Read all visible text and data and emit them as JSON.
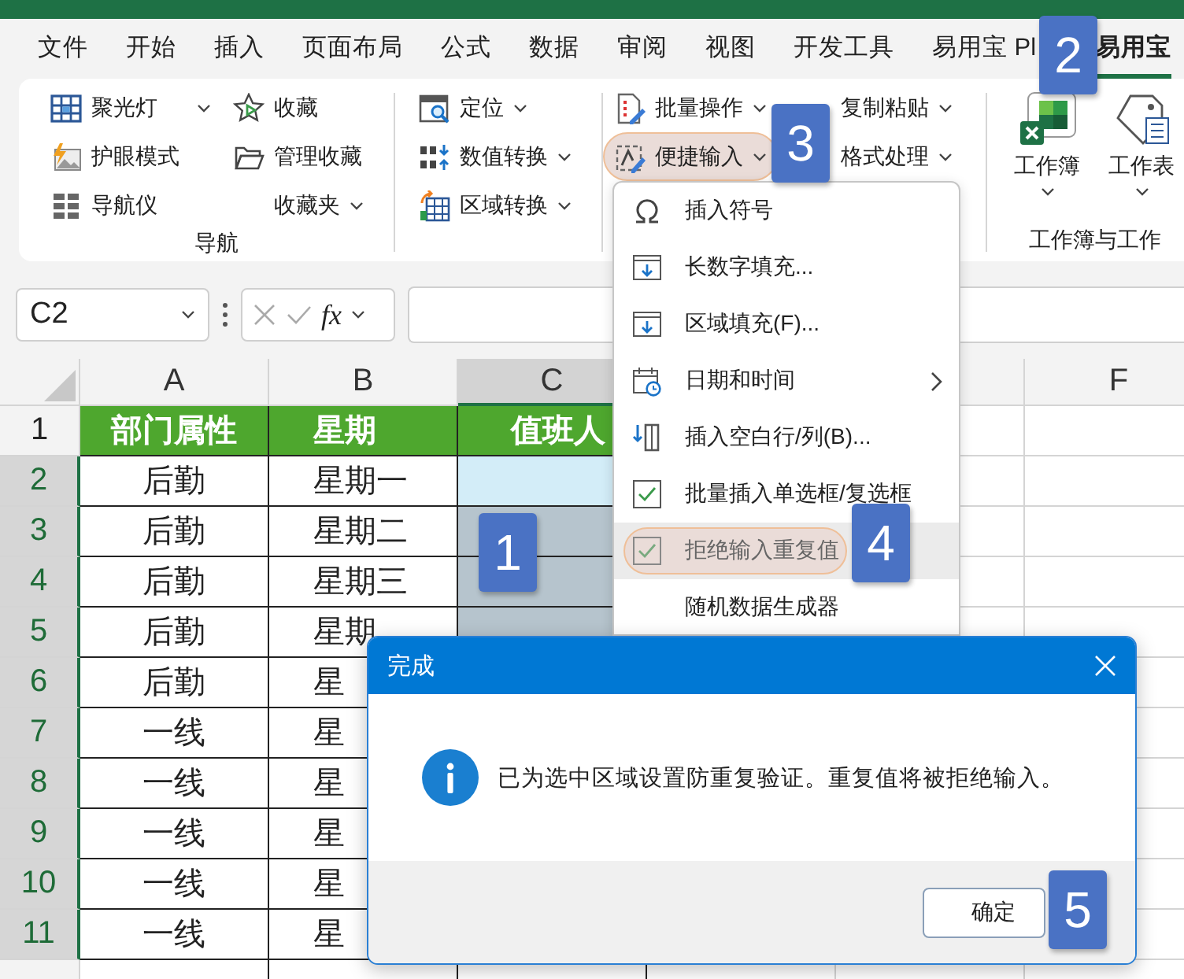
{
  "tabs": [
    {
      "label": "文件",
      "selected": false
    },
    {
      "label": "开始",
      "selected": false
    },
    {
      "label": "插入",
      "selected": false
    },
    {
      "label": "页面布局",
      "selected": false
    },
    {
      "label": "公式",
      "selected": false
    },
    {
      "label": "数据",
      "selected": false
    },
    {
      "label": "审阅",
      "selected": false
    },
    {
      "label": "视图",
      "selected": false
    },
    {
      "label": "开发工具",
      "selected": false
    },
    {
      "label": "易用宝 Pl",
      "selected": false
    },
    {
      "label": "易用宝",
      "selected": true
    }
  ],
  "ribbon": {
    "groups": [
      {
        "kind": "small",
        "label": "导航",
        "columns": [
          [
            {
              "label": "聚光灯",
              "dropdown": true,
              "highlighted": false
            },
            {
              "label": "护眼模式",
              "dropdown": false,
              "highlighted": false
            },
            {
              "label": "导航仪",
              "dropdown": false,
              "highlighted": false
            }
          ],
          [
            {
              "label": "收藏",
              "dropdown": false,
              "highlighted": false
            },
            {
              "label": "管理收藏",
              "dropdown": false,
              "highlighted": false
            },
            {
              "label": "收藏夹",
              "dropdown": true,
              "highlighted": false
            }
          ]
        ]
      },
      {
        "kind": "small",
        "columns": [
          [
            {
              "label": "定位",
              "dropdown": true,
              "highlighted": false
            },
            {
              "label": "数值转换",
              "dropdown": true,
              "highlighted": false
            },
            {
              "label": "区域转换",
              "dropdown": true,
              "highlighted": false
            }
          ]
        ]
      },
      {
        "kind": "small",
        "columns": [
          [
            {
              "label": "批量操作",
              "dropdown": true,
              "highlighted": false
            },
            {
              "label": "便捷输入",
              "dropdown": true,
              "highlighted": true
            }
          ],
          [
            {
              "label": "复制粘贴",
              "dropdown": true,
              "highlighted": false
            },
            {
              "label": "格式处理",
              "dropdown": true,
              "highlighted": false
            }
          ]
        ]
      },
      {
        "kind": "large",
        "label": "工作簿与工作",
        "buttons": [
          {
            "label": "工作簿",
            "dropdown": true
          },
          {
            "label": "工作表",
            "dropdown": true
          }
        ]
      }
    ]
  },
  "formula_bar": {
    "name_box": "C2",
    "function_label": "fx"
  },
  "sheet": {
    "columns": [
      {
        "label": "A",
        "selected": false
      },
      {
        "label": "B",
        "selected": false
      },
      {
        "label": "C",
        "selected": true
      },
      {
        "label": "F",
        "selected": false
      }
    ],
    "rows": [
      {
        "number": "1",
        "kind": "header",
        "selected": false,
        "cells": [
          {
            "text": "部门属性",
            "selected": false,
            "active": false
          },
          {
            "text": "星期",
            "selected": false,
            "active": false
          },
          {
            "text": "值班人",
            "selected": false,
            "active": false
          }
        ]
      },
      {
        "number": "2",
        "kind": "data",
        "selected": true,
        "cells": [
          {
            "text": "后勤",
            "selected": false,
            "active": false
          },
          {
            "text": "星期一",
            "selected": false,
            "active": false
          },
          {
            "selected": false,
            "active": true
          }
        ]
      },
      {
        "number": "3",
        "kind": "data",
        "selected": true,
        "cells": [
          {
            "text": "后勤",
            "selected": false,
            "active": false
          },
          {
            "text": "星期二",
            "selected": false,
            "active": false
          },
          {
            "selected": true,
            "active": false
          }
        ]
      },
      {
        "number": "4",
        "kind": "data",
        "selected": true,
        "cells": [
          {
            "text": "后勤",
            "selected": false,
            "active": false
          },
          {
            "text": "星期三",
            "selected": false,
            "active": false
          },
          {
            "selected": true,
            "active": false
          }
        ]
      },
      {
        "number": "5",
        "kind": "data",
        "selected": true,
        "cells": [
          {
            "text": "后勤",
            "selected": false,
            "active": false
          },
          {
            "text": "星期",
            "selected": false,
            "active": false
          },
          {
            "selected": true,
            "active": false
          }
        ]
      },
      {
        "number": "6",
        "kind": "data",
        "selected": true,
        "cells": [
          {
            "text": "后勤",
            "selected": false,
            "active": false
          },
          {
            "text": "星",
            "selected": false,
            "active": false
          }
        ]
      },
      {
        "number": "7",
        "kind": "data",
        "selected": true,
        "cells": [
          {
            "text": "一线",
            "selected": false,
            "active": false
          },
          {
            "text": "星",
            "selected": false,
            "active": false
          }
        ]
      },
      {
        "number": "8",
        "kind": "data",
        "selected": true,
        "cells": [
          {
            "text": "一线",
            "selected": false,
            "active": false
          },
          {
            "text": "星",
            "selected": false,
            "active": false
          }
        ]
      },
      {
        "number": "9",
        "kind": "data",
        "selected": true,
        "cells": [
          {
            "text": "一线",
            "selected": false,
            "active": false
          },
          {
            "text": "星",
            "selected": false,
            "active": false
          }
        ]
      },
      {
        "number": "10",
        "kind": "data",
        "selected": true,
        "cells": [
          {
            "text": "一线",
            "selected": false,
            "active": false
          },
          {
            "text": "星",
            "selected": false,
            "active": false
          }
        ]
      },
      {
        "number": "11",
        "kind": "data",
        "selected": true,
        "cells": [
          {
            "text": "一线",
            "selected": false,
            "active": false
          },
          {
            "text": "星",
            "selected": false,
            "active": false
          }
        ]
      }
    ]
  },
  "menu": {
    "items": [
      {
        "label": "插入符号",
        "submenu": false,
        "highlighted": false
      },
      {
        "label": "长数字填充...",
        "submenu": false,
        "highlighted": false
      },
      {
        "label": "区域填充(F)...",
        "submenu": false,
        "highlighted": false
      },
      {
        "label": "日期和时间",
        "submenu": true,
        "highlighted": false
      },
      {
        "label": "插入空白行/列(B)...",
        "submenu": false,
        "highlighted": false
      },
      {
        "label": "批量插入单选框/复选框",
        "submenu": false,
        "highlighted": false
      },
      {
        "label": "拒绝输入重复值",
        "submenu": false,
        "highlighted": true
      },
      {
        "label": "随机数据生成器",
        "submenu": false,
        "highlighted": false
      }
    ]
  },
  "dialog": {
    "title": "完成",
    "message": "已为选中区域设置防重复验证。重复值将被拒绝输入。",
    "buttons": [
      "确定"
    ]
  },
  "step_badges": [
    "1",
    "2",
    "3",
    "4",
    "5"
  ]
}
